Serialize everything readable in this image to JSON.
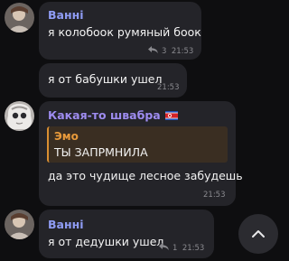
{
  "colors": {
    "vanni": "#8f9cf4",
    "kakaya": "#9e8cf0",
    "quote_name": "#e89a3b",
    "bubble": "#242429",
    "background": "#0e0e10"
  },
  "messages": [
    {
      "sender": "Ванні",
      "text": "я колобоок румяный боок",
      "replies": "3",
      "time": "21:53"
    },
    {
      "text": "я от бабушки ушел",
      "time": "21:53"
    },
    {
      "sender": "Какая-то швабра",
      "flag": "north-korea-flag-icon",
      "quote": {
        "name": "Эмо",
        "text": "ТЫ ЗАПРМНИЛА"
      },
      "text": "да это чудище лесное забудешь",
      "time": "21:53"
    },
    {
      "sender": "Ванні",
      "text": "я от дедушки ушел",
      "replies": "1",
      "time": "21:53"
    }
  ],
  "scroll_button": {
    "icon": "chevron-up-icon"
  }
}
